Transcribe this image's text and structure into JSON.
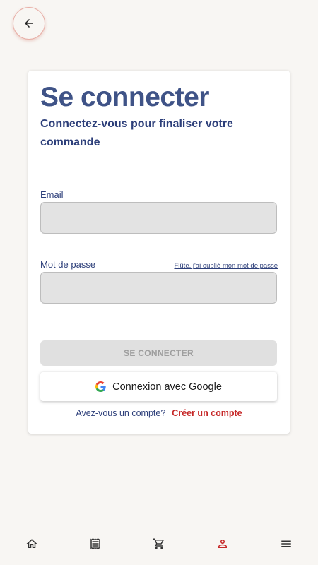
{
  "header": {
    "back_icon": "arrow-left-icon"
  },
  "login": {
    "title": "Se connecter",
    "subtitle": "Connectez-vous pour finaliser votre commande",
    "email_label": "Email",
    "email_value": "",
    "password_label": "Mot de passe",
    "password_value": "",
    "forgot_link": "Flûte, j'ai oublié mon mot de passe",
    "submit_label": "SE CONNECTER",
    "google_label": "Connexion avec Google",
    "signup_question": "Avez-vous un compte?",
    "signup_link": "Créer un compte"
  },
  "bottom_nav": {
    "items": [
      {
        "icon": "home-icon",
        "active": false
      },
      {
        "icon": "receipt-icon",
        "active": false
      },
      {
        "icon": "cart-icon",
        "active": false
      },
      {
        "icon": "account-icon",
        "active": true
      },
      {
        "icon": "menu-icon",
        "active": false
      }
    ]
  },
  "colors": {
    "primary": "#3f5387",
    "accent": "#c62828",
    "background": "#f8f6f3",
    "nav_icon": "#333333"
  }
}
